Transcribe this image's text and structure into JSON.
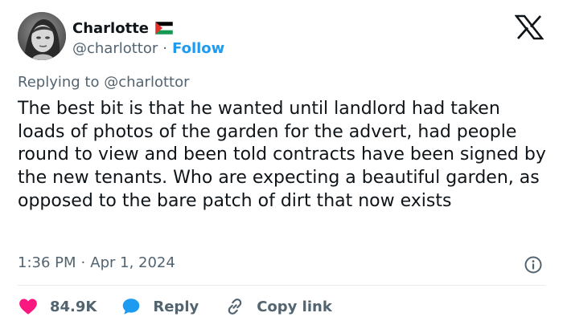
{
  "author": {
    "name": "Charlotte",
    "flag_icon": "palestine-flag-icon",
    "handle": "@charlottor",
    "separator": "·",
    "follow_label": "Follow"
  },
  "brand_icon": "x-logo-icon",
  "replying": {
    "prefix": "Replying to",
    "handle": "@charlottor"
  },
  "tweet": {
    "text": "The best bit is that he wanted until landlord had taken loads of photos of the garden for the advert, had people round to view and been told contracts have been signed by the new tenants. Who are expecting a beautiful garden, as opposed to the bare patch of dirt that now exists",
    "time": "1:36 PM",
    "separator": "·",
    "date": "Apr 1, 2024",
    "info_icon": "info-icon"
  },
  "actions": {
    "like_count": "84.9K",
    "reply_label": "Reply",
    "copy_link_label": "Copy link"
  },
  "colors": {
    "accent": "#1d9bf0",
    "like": "#f91880",
    "text": "#0f1419",
    "muted": "#536471"
  }
}
